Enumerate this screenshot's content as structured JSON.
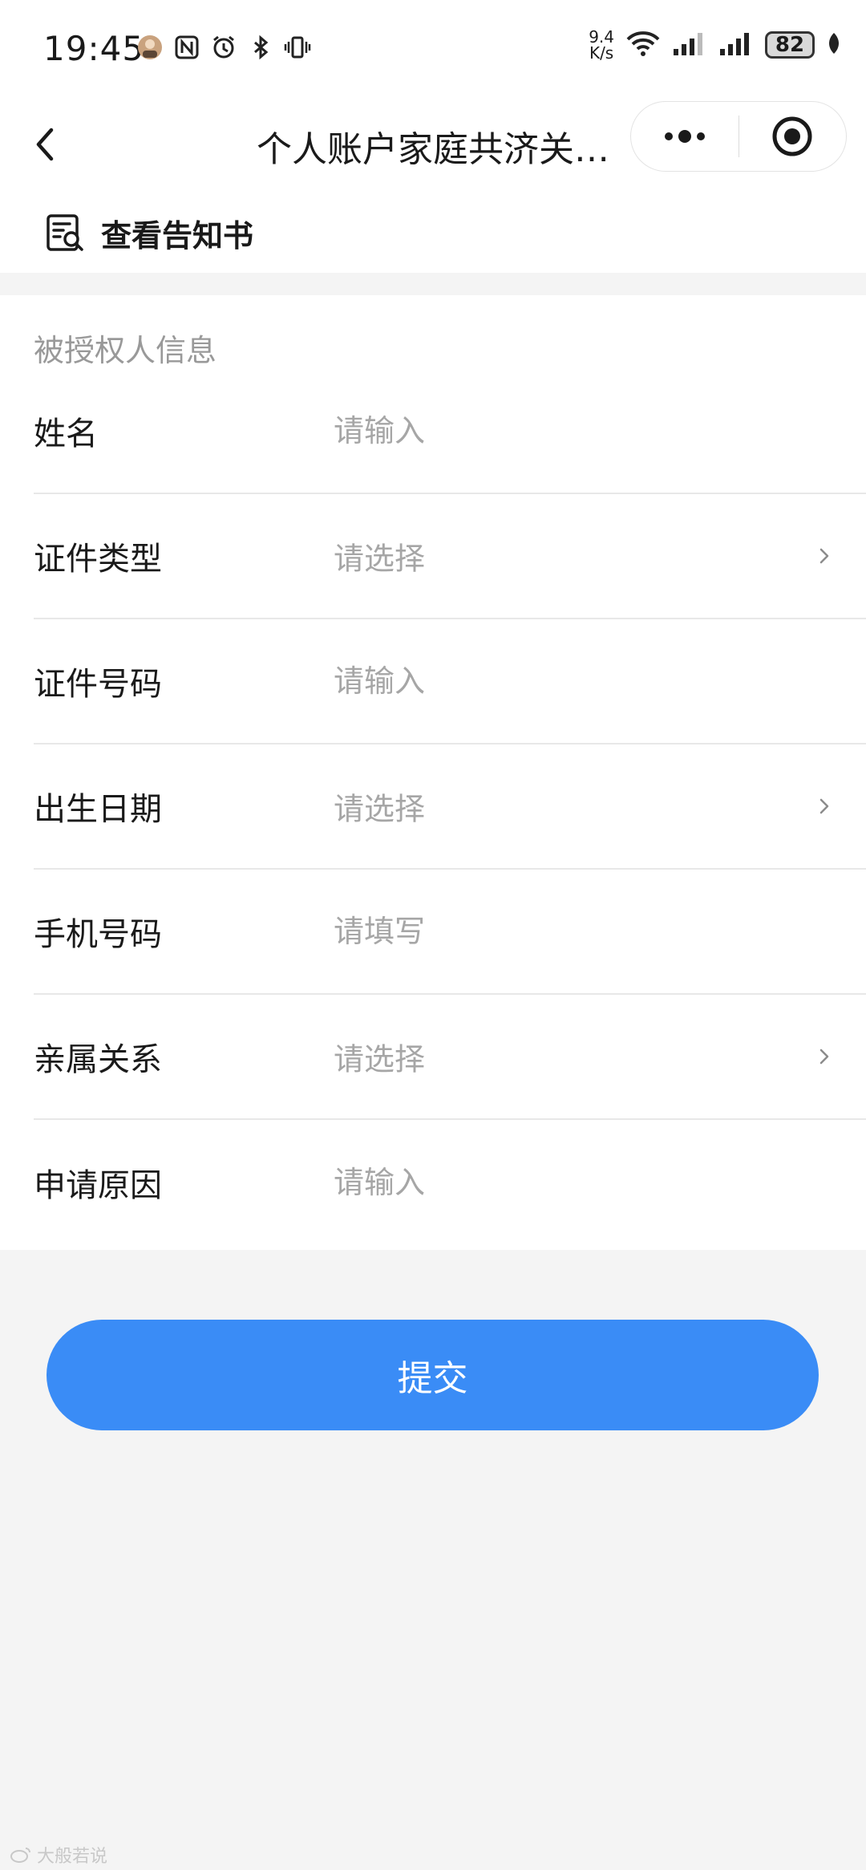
{
  "status_bar": {
    "time": "19:45",
    "net_speed_value": "9.4",
    "net_speed_unit": "K/s",
    "battery": "82"
  },
  "nav": {
    "title": "个人账户家庭共济关…"
  },
  "notice": {
    "label": "查看告知书"
  },
  "form": {
    "section_title": "被授权人信息",
    "fields": [
      {
        "label": "姓名",
        "placeholder": "请输入"
      },
      {
        "label": "证件类型",
        "placeholder": "请选择"
      },
      {
        "label": "证件号码",
        "placeholder": "请输入"
      },
      {
        "label": "出生日期",
        "placeholder": "请选择"
      },
      {
        "label": "手机号码",
        "placeholder": "请填写"
      },
      {
        "label": "亲属关系",
        "placeholder": "请选择"
      },
      {
        "label": "申请原因",
        "placeholder": "请输入"
      }
    ]
  },
  "submit_label": "提交",
  "watermark": "大般若说",
  "colors": {
    "primary": "#3a8cf6",
    "placeholder": "#a6a6a6",
    "background": "#f4f4f4"
  }
}
